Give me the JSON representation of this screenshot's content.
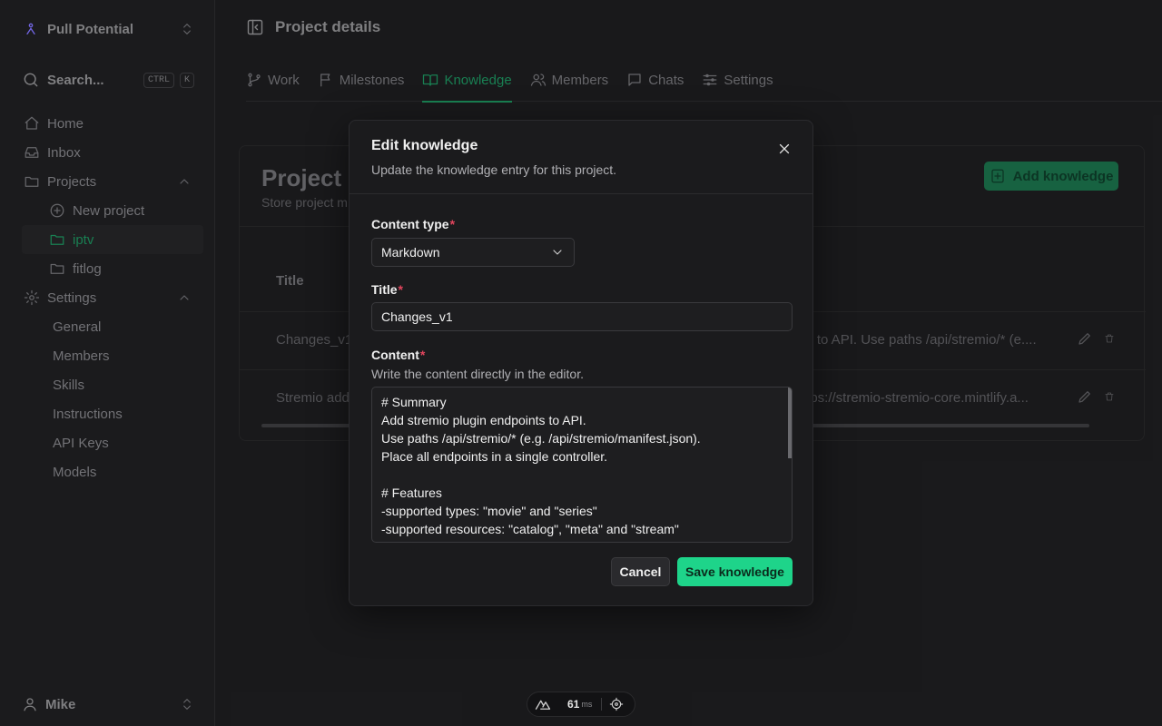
{
  "sidebar": {
    "workspace": "Pull Potential",
    "search": {
      "label": "Search...",
      "keys": [
        "CTRL",
        "K"
      ]
    },
    "items": {
      "home": "Home",
      "inbox": "Inbox",
      "projects": "Projects",
      "new_project": "New project",
      "iptv": "iptv",
      "fitlog": "fitlog",
      "settings": "Settings",
      "general": "General",
      "members": "Members",
      "skills": "Skills",
      "instructions": "Instructions",
      "api_keys": "API Keys",
      "models": "Models"
    },
    "user": "Mike"
  },
  "header": {
    "title": "Project details"
  },
  "tabs": {
    "work": "Work",
    "milestones": "Milestones",
    "knowledge": "Knowledge",
    "members": "Members",
    "chats": "Chats",
    "settings": "Settings",
    "active": "knowledge"
  },
  "knowledge_card": {
    "title": "Project k",
    "subtitle": "Store project m",
    "add_button": "Add knowledge",
    "table": {
      "header_title": "Title",
      "rows": [
        {
          "title": "Changes_v1",
          "content": "ts to API. Use paths /api/stremio/* (e...."
        },
        {
          "title": "Stremio add",
          "content": "ttps://stremio-stremio-core.mintlify.a..."
        }
      ]
    }
  },
  "modal": {
    "title": "Edit knowledge",
    "subtitle": "Update the knowledge entry for this project.",
    "content_type_label": "Content type",
    "content_type_value": "Markdown",
    "title_label": "Title",
    "title_value": "Changes_v1",
    "content_label": "Content",
    "content_help": "Write the content directly in the editor.",
    "content_value": "# Summary\nAdd stremio plugin endpoints to API.\nUse paths /api/stremio/* (e.g. /api/stremio/manifest.json).\nPlace all endpoints in a single controller.\n\n# Features\n-supported types: \"movie\" and \"series\"\n-supported resources: \"catalog\", \"meta\" and \"stream\"\n-catalogs and stream",
    "required_marker": "*",
    "cancel": "Cancel",
    "save": "Save knowledge"
  },
  "devtools": {
    "value": "61",
    "unit": "ms"
  },
  "colors": {
    "accent": "#1ed48a",
    "accent_dim": "#1c8a5a",
    "required": "#e2455d",
    "background": "#1c1c1e",
    "modal": "#1b1b1d"
  }
}
